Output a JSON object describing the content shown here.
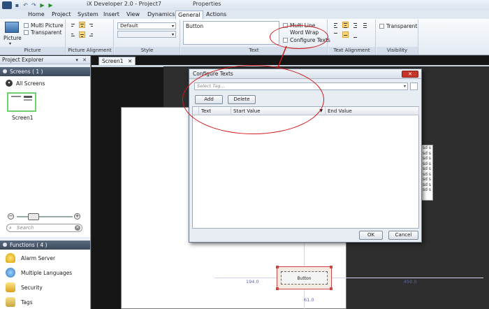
{
  "window": {
    "title": "iX Developer 2.0 - Project7",
    "context_title": "Properties"
  },
  "menu": {
    "tabs": [
      "Home",
      "Project",
      "System",
      "Insert",
      "View",
      "Dynamics",
      "General",
      "Actions"
    ],
    "active": "General"
  },
  "ribbon": {
    "picture": {
      "button_label": "Picture",
      "multi_picture": "Multi Picture",
      "transparent": "Transparent",
      "group_label": "Picture"
    },
    "picture_alignment": {
      "group_label": "Picture Alignment"
    },
    "style": {
      "value": "Default",
      "group_label": "Style"
    },
    "text": {
      "value": "Button",
      "multi_line": "Multi Line",
      "word_wrap": "Word Wrap",
      "configure_texts": "Configure Texts",
      "group_label": "Text"
    },
    "text_alignment": {
      "group_label": "Text Alignment"
    },
    "visibility": {
      "transparent": "Transparent",
      "group_label": "Visibility"
    }
  },
  "project_explorer": {
    "title": "Project Explorer",
    "screens": {
      "header": "Screens ( 1 )",
      "all_screens": "All Screens",
      "items": [
        {
          "label": "Screen1"
        }
      ]
    },
    "search_placeholder": "Search",
    "functions": {
      "header": "Functions ( 4 )",
      "items": [
        {
          "label": "Alarm Server",
          "icon": "bell-icon"
        },
        {
          "label": "Multiple Languages",
          "icon": "globe-icon"
        },
        {
          "label": "Security",
          "icon": "lock-icon"
        },
        {
          "label": "Tags",
          "icon": "tags-icon"
        }
      ]
    }
  },
  "document": {
    "tab_label": "Screen1",
    "guide_labels": {
      "left": "194.0",
      "right": "450.0",
      "bottom": "61.0"
    },
    "button_text": "Button",
    "side_text_lines": [
      "f sd s",
      "f sd s",
      "f sd s",
      "f sd s",
      "f sd s",
      "f sd s",
      "f sd s",
      "f sd s",
      "f sd s"
    ]
  },
  "dialog": {
    "title": "Configure Texts",
    "tag_placeholder": "Select Tag...",
    "add_label": "Add",
    "delete_label": "Delete",
    "columns": [
      "Text",
      "Start Value",
      "End Value"
    ],
    "ok_label": "OK",
    "cancel_label": "Cancel"
  },
  "colors": {
    "annotation": "#d01818",
    "selection_green": "#6fd06f",
    "close_red": "#c6352a"
  }
}
